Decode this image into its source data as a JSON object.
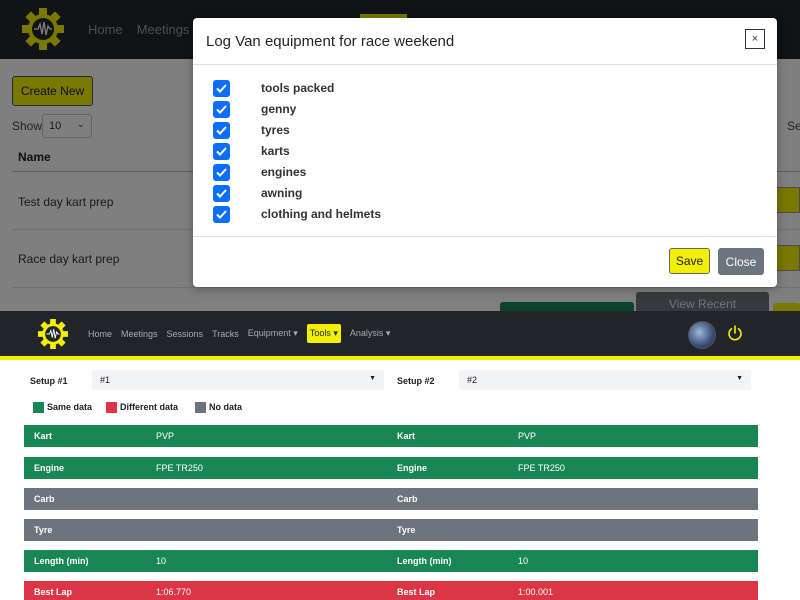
{
  "nav": {
    "items": [
      "Home",
      "Meetings",
      "Sessions",
      "Tracks",
      "Equipment",
      "Tools",
      "Analysis"
    ],
    "top_visible": [
      "Home",
      "Meetings",
      "S"
    ]
  },
  "list_page": {
    "create_button": "Create New",
    "show_label": "Show",
    "show_value": "10",
    "search_partial": "Se",
    "column_name": "Name",
    "rows": [
      "Test day kart prep",
      "Race day kart prep"
    ],
    "view_recent_button": "View Recent"
  },
  "modal": {
    "title": "Log Van equipment for race weekend",
    "close_symbol": "×",
    "items": [
      {
        "label": "tools packed",
        "checked": true
      },
      {
        "label": "genny",
        "checked": true
      },
      {
        "label": "tyres",
        "checked": true
      },
      {
        "label": "karts",
        "checked": true
      },
      {
        "label": "engines",
        "checked": true
      },
      {
        "label": "awning",
        "checked": true
      },
      {
        "label": "clothing and helmets",
        "checked": true
      }
    ],
    "save_button": "Save",
    "close_button": "Close"
  },
  "compare": {
    "setup1_label": "Setup #1",
    "setup1_value": "#1",
    "setup2_label": "Setup #2",
    "setup2_value": "#2",
    "legend": [
      {
        "label": "Same data",
        "color": "#198754"
      },
      {
        "label": "Different data",
        "color": "#dc3545"
      },
      {
        "label": "No data",
        "color": "#6c757d"
      }
    ],
    "rows": [
      {
        "label": "Kart",
        "v1": "PVP",
        "v2": "PVP",
        "status": "same"
      },
      {
        "label": "Engine",
        "v1": "FPE TR250",
        "v2": "FPE TR250",
        "status": "same"
      },
      {
        "label": "Carb",
        "v1": "",
        "v2": "",
        "status": "none"
      },
      {
        "label": "Tyre",
        "v1": "",
        "v2": "",
        "status": "none"
      },
      {
        "label": "Length (min)",
        "v1": "10",
        "v2": "10",
        "status": "same"
      },
      {
        "label": "Best Lap",
        "v1": "1:06.770",
        "v2": "1:00.001",
        "status": "different"
      }
    ]
  },
  "colors": {
    "brand_yellow": "#f2f000",
    "nav_dark": "#212529",
    "checkbox_blue": "#0d6efd",
    "same": "#198754",
    "different": "#dc3545",
    "none": "#6c757d"
  }
}
